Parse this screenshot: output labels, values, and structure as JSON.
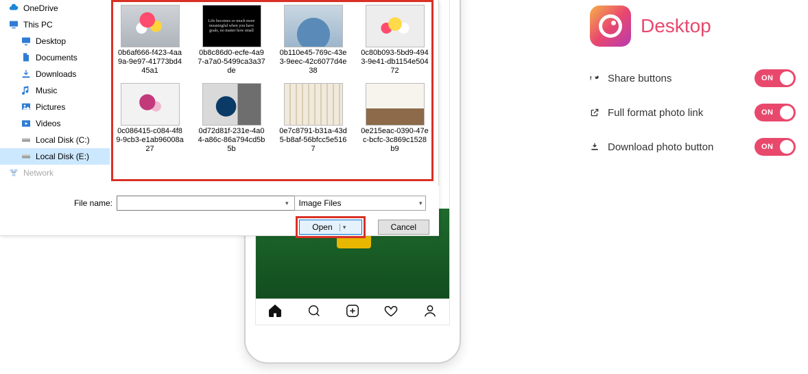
{
  "dialog": {
    "tree": [
      {
        "icon": "onedrive",
        "label": "OneDrive",
        "indent": false
      },
      {
        "icon": "thispc",
        "label": "This PC",
        "indent": false
      },
      {
        "icon": "desktop",
        "label": "Desktop",
        "indent": true
      },
      {
        "icon": "documents",
        "label": "Documents",
        "indent": true
      },
      {
        "icon": "downloads",
        "label": "Downloads",
        "indent": true
      },
      {
        "icon": "music",
        "label": "Music",
        "indent": true
      },
      {
        "icon": "pictures",
        "label": "Pictures",
        "indent": true
      },
      {
        "icon": "videos",
        "label": "Videos",
        "indent": true
      },
      {
        "icon": "disk",
        "label": "Local Disk (C:)",
        "indent": true
      },
      {
        "icon": "disk",
        "label": "Local Disk (E:)",
        "indent": true,
        "selected": true
      },
      {
        "icon": "network",
        "label": "Network",
        "indent": false,
        "faded": true
      }
    ],
    "files": [
      {
        "art": "art-flowers1",
        "name": "0b6af666-f423-4aa9a-9e97-41773bd445a1"
      },
      {
        "art": "art-blacktxt",
        "name": "0b8c86d0-ecfe-4a97-a7a0-5499ca3a37de",
        "quote": "Life becomes so much more meaningful when you have goals, no matter how small"
      },
      {
        "art": "art-table",
        "name": "0b110e45-769c-43e3-9eec-42c6077d4e38"
      },
      {
        "art": "art-bouquet",
        "name": "0c80b093-5bd9-4943-9e41-db1154e50472"
      },
      {
        "art": "art-bouquet2",
        "name": "0c086415-c084-4f89-9cb3-e1ab96008a27"
      },
      {
        "art": "art-record",
        "name": "0d72d81f-231e-4a04-a86c-86a794cd5b5b"
      },
      {
        "art": "art-chairs",
        "name": "0e7c8791-b31a-43d5-b8af-56bfcc5e5167"
      },
      {
        "art": "art-loft",
        "name": "0e215eac-0390-47ec-bcfc-3c869c1528b9"
      }
    ],
    "filename_label": "File name:",
    "filename_value": "",
    "filter_label": "Image Files",
    "open_label": "Open",
    "cancel_label": "Cancel"
  },
  "extension": {
    "title": "Desktop",
    "options": [
      {
        "icon": "share",
        "label": "Share buttons",
        "state": "ON"
      },
      {
        "icon": "link",
        "label": "Full format photo link",
        "state": "ON"
      },
      {
        "icon": "download",
        "label": "Download photo button",
        "state": "ON"
      }
    ]
  },
  "icons": {
    "onedrive": "#2e7cd6",
    "thispc": "#2e7cd6",
    "desktop": "#2e7cd6",
    "documents": "#2e7cd6",
    "downloads": "#2e7cd6",
    "music": "#2e7cd6",
    "pictures": "#2e7cd6",
    "videos": "#2e7cd6",
    "disk": "#777",
    "network": "#2e7cd6"
  }
}
